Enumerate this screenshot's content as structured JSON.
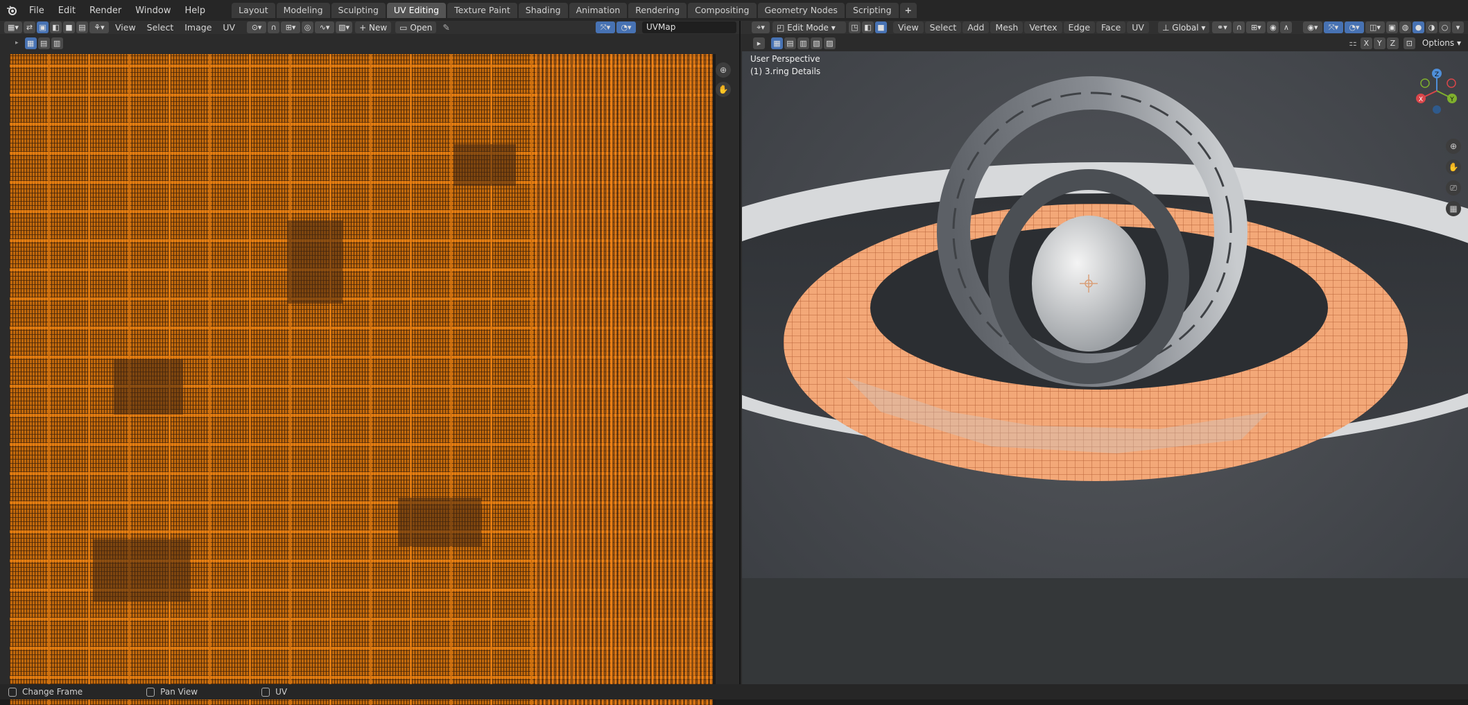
{
  "menu": {
    "items": [
      "File",
      "Edit",
      "Render",
      "Window",
      "Help"
    ]
  },
  "workspaces": {
    "tabs": [
      "Layout",
      "Modeling",
      "Sculpting",
      "UV Editing",
      "Texture Paint",
      "Shading",
      "Animation",
      "Rendering",
      "Compositing",
      "Geometry Nodes",
      "Scripting"
    ],
    "active": "UV Editing"
  },
  "uv_editor": {
    "menus": [
      "View",
      "Select",
      "Image",
      "UV"
    ],
    "new_label": "New",
    "open_label": "Open",
    "uvmap_value": "UVMap"
  },
  "viewport": {
    "mode": "Edit Mode",
    "menus": [
      "View",
      "Select",
      "Add",
      "Mesh",
      "Vertex",
      "Edge",
      "Face",
      "UV"
    ],
    "transform_orientation": "Global",
    "axes": [
      "X",
      "Y",
      "Z"
    ],
    "options_label": "Options",
    "overlay_line1": "User Perspective",
    "overlay_line2": "(1) 3.ring Details",
    "gizmo_labels": {
      "x": "X",
      "y": "Y",
      "z": "Z"
    }
  },
  "status": {
    "items": [
      "Change Frame",
      "Pan View",
      "UV"
    ]
  },
  "colors": {
    "accent": "#4772b3",
    "uv_orange": "#ff8a1a",
    "selected_mesh": "#f2a777"
  }
}
